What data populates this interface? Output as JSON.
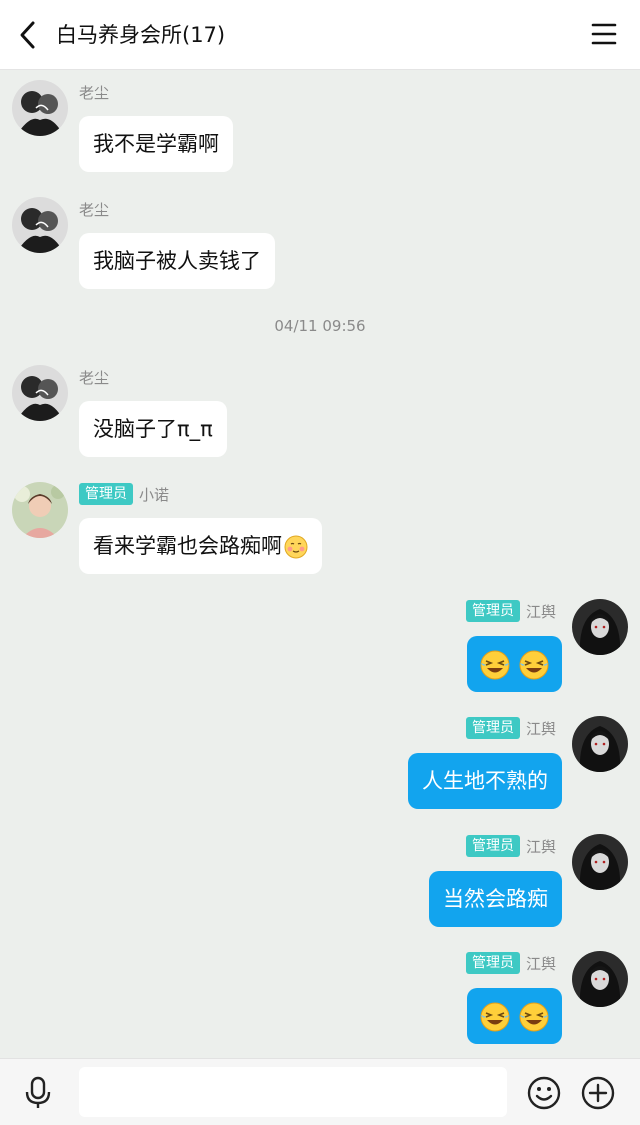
{
  "header": {
    "title": "白马养身会所(17)"
  },
  "messages": [
    {
      "side": "left",
      "sender": "老尘",
      "badge": "",
      "text": "我不是学霸啊",
      "avatar": "bw-manga-couple-avatar"
    },
    {
      "side": "left",
      "sender": "老尘",
      "badge": "",
      "text": "我脑子被人卖钱了",
      "avatar": "bw-manga-couple-avatar"
    },
    {
      "side": "left",
      "sender": "老尘",
      "badge": "",
      "text": "没脑子了π_π",
      "avatar": "bw-manga-couple-avatar"
    },
    {
      "side": "left",
      "sender": "小诺",
      "badge": "管理员",
      "text": "看来学霸也会路痴啊",
      "emoji": "shy-smile-emoji",
      "avatar": "girl-photo-avatar"
    },
    {
      "side": "right",
      "sender": "江舆",
      "badge": "管理员",
      "text": "",
      "emoji": "laugh-cry-emoji x2",
      "avatar": "dark-anime-girl-avatar"
    },
    {
      "side": "right",
      "sender": "江舆",
      "badge": "管理员",
      "text": "人生地不熟的",
      "avatar": "dark-anime-girl-avatar"
    },
    {
      "side": "right",
      "sender": "江舆",
      "badge": "管理员",
      "text": "当然会路痴",
      "avatar": "dark-anime-girl-avatar"
    },
    {
      "side": "right",
      "sender": "江舆",
      "badge": "管理员",
      "text": "",
      "emoji": "laugh-cry-emoji x2",
      "avatar": "dark-anime-girl-avatar"
    }
  ],
  "timestamp": "04/11 09:56",
  "input": {
    "placeholder": "",
    "value": ""
  },
  "colors": {
    "background": "#ecefec",
    "bubble_self": "#12a4ee",
    "badge": "#3ec9c4"
  }
}
